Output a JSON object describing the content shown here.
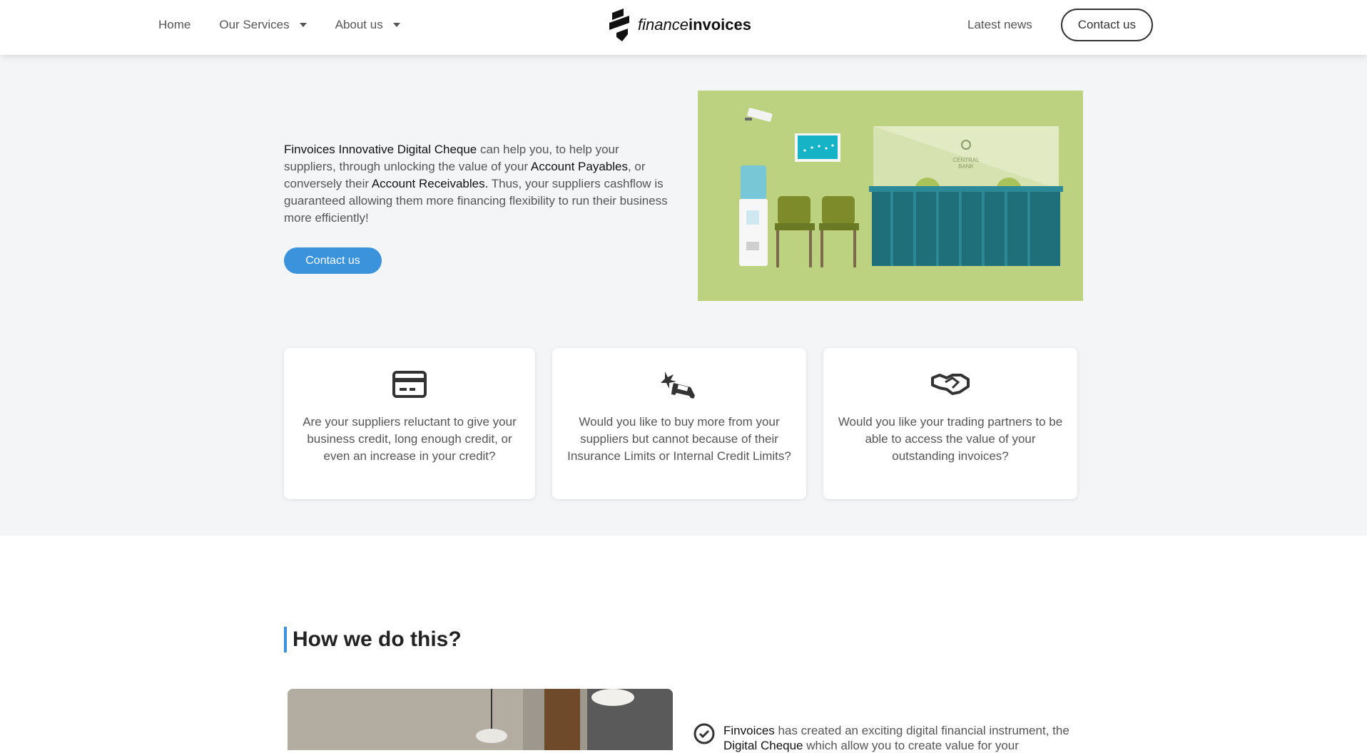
{
  "header": {
    "nav_left": [
      {
        "label": "Home"
      },
      {
        "label": "Our Services"
      },
      {
        "label": "About us"
      }
    ],
    "logo": {
      "prefix": "finance",
      "suffix": "invoices"
    },
    "nav_right": {
      "latest_news": "Latest news",
      "contact": "Contact us"
    }
  },
  "hero": {
    "text_parts": [
      "Finvoices Innovative Digital Cheque",
      " can help you, to help your suppliers, through unlocking the value of your ",
      "Account Payables",
      ", or conversely their ",
      "Account Receivables.",
      " Thus, your suppliers cashflow is guaranteed allowing them more financing flexibility to run their business more efficiently!"
    ],
    "cta": "Contact us",
    "illustration_text": [
      "CENTRAL",
      "BANK"
    ]
  },
  "cards": [
    {
      "icon": "credit-card-icon",
      "text": "Are your suppliers reluctant to give your business credit, long enough credit, or even an increase in your credit?"
    },
    {
      "icon": "car-crash-icon",
      "text": "Would you like to buy more from your suppliers but cannot because of their Insurance Limits or Internal Credit Limits?"
    },
    {
      "icon": "handshake-icon",
      "text": "Would you like your trading partners to be able to access the value of your outstanding invoices?"
    }
  ],
  "how": {
    "title": "How we do this?",
    "item_parts": [
      "Finvoices",
      " has created an exciting digital financial instrument, the ",
      "Digital Cheque",
      " which allow you to create value for your"
    ]
  },
  "colors": {
    "accent": "#3b93dc",
    "hero_bg": "#f4f5f7",
    "illustration_bg": "#bdd280",
    "desk": "#1f6f7a"
  }
}
